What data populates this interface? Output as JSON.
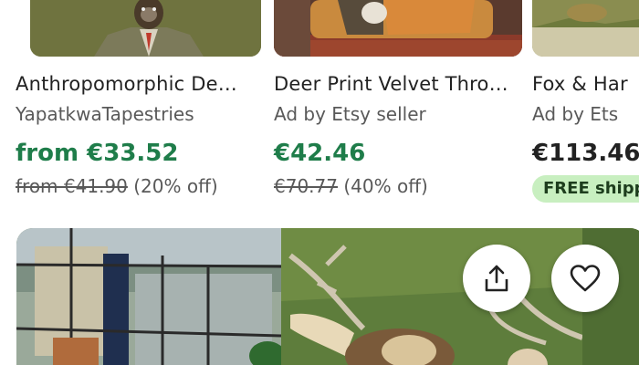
{
  "listings": [
    {
      "title": "Anthropomorphic De…",
      "shop": "YapatkwaTapestries",
      "price": "from €33.52",
      "original_price": "from €41.90",
      "discount": "(20% off)"
    },
    {
      "title": "Deer Print Velvet Thro…",
      "shop": "Ad by Etsy seller",
      "price": "€42.46",
      "original_price": "€70.77",
      "discount": "(40% off)"
    },
    {
      "title": "Fox & Har",
      "shop": "Ad by Ets",
      "price": "€113.46",
      "badge": "FREE shipp"
    }
  ],
  "hero": {
    "share_icon": "share-icon",
    "favorite_icon": "heart-icon"
  },
  "colors": {
    "sale_price": "#1f7d4a",
    "badge_bg": "#c8efc0",
    "muted_text": "#595959"
  }
}
